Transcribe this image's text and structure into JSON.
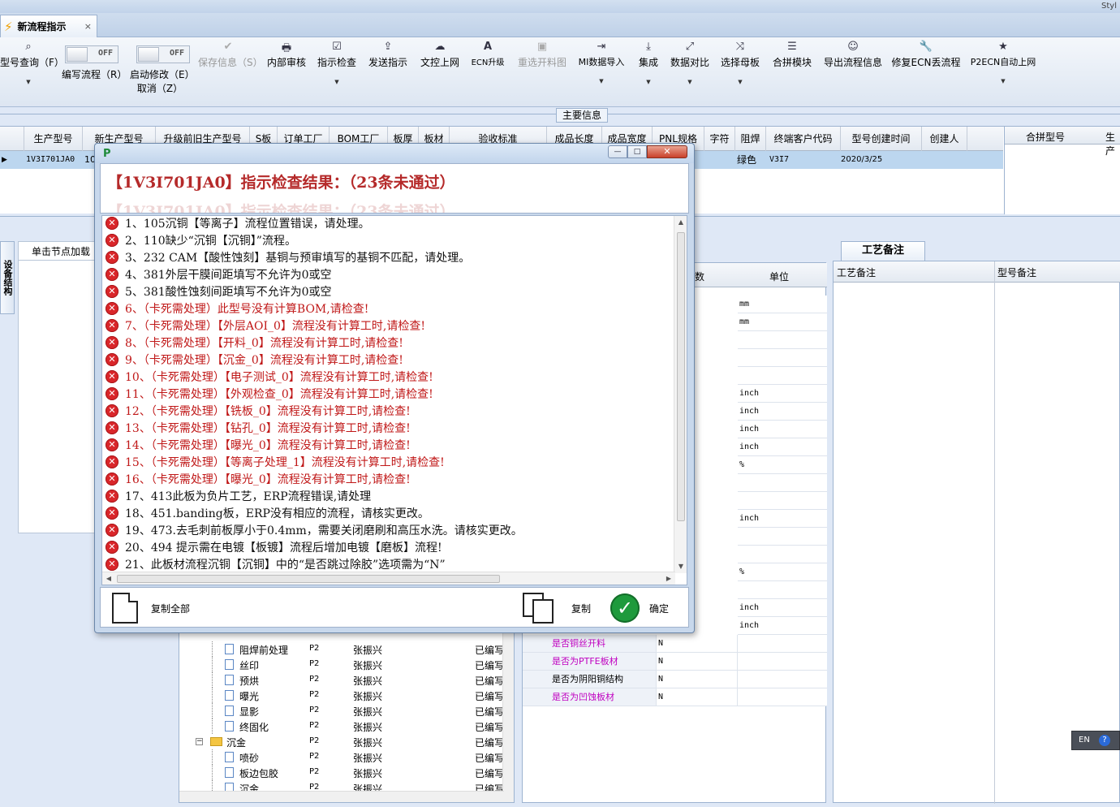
{
  "window": {
    "style_label": "Styl",
    "tab_title": "新流程指示",
    "tab_close": "×"
  },
  "ribbon": {
    "toggles": [
      {
        "state": "OFF",
        "caption": "编写流程（R）"
      },
      {
        "state": "OFF",
        "caption": "启动修改（E）",
        "caption2": "取消（Z）"
      }
    ],
    "buttons": [
      {
        "label": "型号查询（F）",
        "icon": "search-icon",
        "dropdown": true
      },
      {
        "label": "保存信息（S）",
        "icon": "check-icon",
        "disabled": true
      },
      {
        "label": "内部审核",
        "icon": "printer-icon"
      },
      {
        "label": "指示检查",
        "icon": "checkbox-icon",
        "dropdown": true
      },
      {
        "label": "发送指示",
        "icon": "upload-icon"
      },
      {
        "label": "文控上网",
        "icon": "cloud-upload-icon"
      },
      {
        "label": "ECN升级",
        "icon": "font-a-icon"
      },
      {
        "label": "重选开料图",
        "icon": "image-icon",
        "disabled": true
      },
      {
        "label": "MI数据导入",
        "icon": "import-icon",
        "dropdown": true
      },
      {
        "label": "集成",
        "icon": "download-icon",
        "dropdown": true
      },
      {
        "label": "数据对比",
        "icon": "compare-icon",
        "dropdown": true
      },
      {
        "label": "选择母板",
        "icon": "shuffle-icon",
        "dropdown": true
      },
      {
        "label": "合拼模块",
        "icon": "list-icon"
      },
      {
        "label": "导出流程信息",
        "icon": "smile-icon"
      },
      {
        "label": "修复ECN丢流程",
        "icon": "wrench-icon"
      },
      {
        "label": "P2ECN自动上网",
        "icon": "star-icon",
        "dropdown": true
      }
    ]
  },
  "main_info": "主要信息",
  "grid": {
    "columns": [
      "生产型号",
      "新生产型号",
      "升级前旧生产型号",
      "S板",
      "订单工厂",
      "BOM工厂",
      "板厚",
      "板材",
      "验收标准",
      "成品长度",
      "成品宽度",
      "PNL规格",
      "字符",
      "阻焊",
      "终端客户代码",
      "型号创建时间",
      "创建人"
    ],
    "right_columns": [
      "合拼型号",
      "生产"
    ],
    "row": {
      "prod_model": "1V3I701JA0",
      "new_model_partial": "10",
      "solder": "绿色",
      "customer": "V3I7",
      "created": "2020/3/25"
    }
  },
  "lower": {
    "vertical_tab": "设备结构",
    "tree_header": "单击节点加载工",
    "params_header": [
      "参数",
      "单位"
    ],
    "notes_tab": "工艺备注",
    "notes_columns": [
      "工艺备注",
      "型号备注"
    ]
  },
  "param_units": [
    "mm",
    "mm",
    "",
    "",
    "",
    "inch",
    "inch",
    "inch",
    "inch",
    "%",
    "",
    "",
    "inch",
    "",
    "",
    "%",
    "",
    "inch",
    "inch"
  ],
  "param_rows": [
    {
      "name": "是否铜丝开料",
      "value": "N",
      "color": "magenta"
    },
    {
      "name": "是否为PTFE板材",
      "value": "N",
      "color": "magenta"
    },
    {
      "name": "是否为阴阳铜结构",
      "value": "N",
      "color": "black"
    },
    {
      "name": "是否为凹蚀板材",
      "value": "N",
      "color": "magenta"
    }
  ],
  "proc_rows": [
    {
      "name": "阻焊前处理",
      "c1": "P2",
      "c2": "张振兴",
      "c3": "已编写",
      "type": "doc"
    },
    {
      "name": "丝印",
      "c1": "P2",
      "c2": "张振兴",
      "c3": "已编写",
      "type": "doc"
    },
    {
      "name": "预烘",
      "c1": "P2",
      "c2": "张振兴",
      "c3": "已编写",
      "type": "doc"
    },
    {
      "name": "曝光",
      "c1": "P2",
      "c2": "张振兴",
      "c3": "已编写",
      "type": "doc"
    },
    {
      "name": "显影",
      "c1": "P2",
      "c2": "张振兴",
      "c3": "已编写",
      "type": "doc"
    },
    {
      "name": "终固化",
      "c1": "P2",
      "c2": "张振兴",
      "c3": "已编写",
      "type": "doc"
    },
    {
      "name": "沉金",
      "c1": "P2",
      "c2": "张振兴",
      "c3": "已编写",
      "type": "folder"
    },
    {
      "name": "喷砂",
      "c1": "P2",
      "c2": "张振兴",
      "c3": "已编写",
      "type": "doc"
    },
    {
      "name": "板边包胶",
      "c1": "P2",
      "c2": "张振兴",
      "c3": "已编写",
      "type": "doc"
    },
    {
      "name": "沉金",
      "c1": "P2",
      "c2": "张振兴",
      "c3": "已编写",
      "type": "doc"
    }
  ],
  "dialog": {
    "title": "【1V3I701JA0】指示检查结果：（23条未通过）",
    "ghost_title": "【1V3I701JA0】指示检查结果：（23条未通过）",
    "messages": [
      {
        "text": "1、105沉铜【等离子】流程位置错误，请处理。",
        "color": "black"
      },
      {
        "text": "2、110缺少“沉铜【沉铜】”流程。",
        "color": "black"
      },
      {
        "text": "3、232 CAM【酸性蚀刻】基铜与预审填写的基铜不匹配，请处理。",
        "color": "black"
      },
      {
        "text": "4、381外层干膜间距填写不允许为0或空",
        "color": "black"
      },
      {
        "text": "5、381酸性蚀刻间距填写不允许为0或空",
        "color": "black"
      },
      {
        "text": "6、（卡死需处理）此型号没有计算BOM,请检查!",
        "color": "red"
      },
      {
        "text": "7、（卡死需处理）【外层AOI_0】流程没有计算工时,请检查!",
        "color": "red"
      },
      {
        "text": "8、（卡死需处理）【开料_0】流程没有计算工时,请检查!",
        "color": "red"
      },
      {
        "text": "9、（卡死需处理）【沉金_0】流程没有计算工时,请检查!",
        "color": "red"
      },
      {
        "text": "10、（卡死需处理）【电子测试_0】流程没有计算工时,请检查!",
        "color": "red"
      },
      {
        "text": "11、（卡死需处理）【外观检查_0】流程没有计算工时,请检查!",
        "color": "red"
      },
      {
        "text": "12、（卡死需处理）【铣板_0】流程没有计算工时,请检查!",
        "color": "red"
      },
      {
        "text": "13、（卡死需处理）【钻孔_0】流程没有计算工时,请检查!",
        "color": "red"
      },
      {
        "text": "14、（卡死需处理）【曝光_0】流程没有计算工时,请检查!",
        "color": "red"
      },
      {
        "text": "15、（卡死需处理）【等离子处理_1】流程没有计算工时,请检查!",
        "color": "red"
      },
      {
        "text": "16、（卡死需处理）【曝光_0】流程没有计算工时,请检查!",
        "color": "red"
      },
      {
        "text": "17、413此板为负片工艺，ERP流程错误,请处理",
        "color": "black"
      },
      {
        "text": "18、451.banding板，ERP没有相应的流程，请核实更改。",
        "color": "black"
      },
      {
        "text": "19、473.去毛刺前板厚小于0.4mm，需要关闭磨刷和高压水洗。请核实更改。",
        "color": "black"
      },
      {
        "text": "20、494 提示需在电镀【板镀】流程后增加电镀【磨板】流程!",
        "color": "black"
      },
      {
        "text": "21、此板材流程沉铜【沉铜】中的“是否跳过除胶”选项需为“N”",
        "color": "black"
      }
    ],
    "copy_all_label": "复制全部",
    "copy_label": "复制",
    "ok_label": "确定",
    "err_glyph": "✕"
  },
  "langbar": {
    "label": "EN",
    "help": "?"
  }
}
